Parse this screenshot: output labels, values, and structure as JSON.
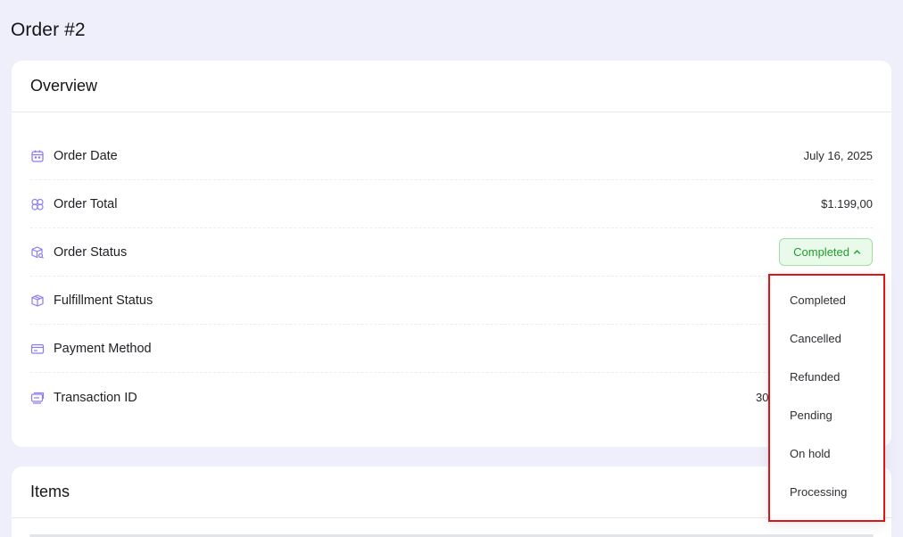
{
  "page": {
    "title": "Order #2"
  },
  "overview": {
    "heading": "Overview",
    "rows": [
      {
        "label": "Order Date",
        "value": "July 16, 2025",
        "icon": "calendar-icon"
      },
      {
        "label": "Order Total",
        "value": "$1.199,00",
        "icon": "coins-icon"
      },
      {
        "label": "Order Status",
        "value": "Completed",
        "icon": "package-search-icon"
      },
      {
        "label": "Fulfillment Status",
        "value": "",
        "icon": "box-icon"
      },
      {
        "label": "Payment Method",
        "value": "",
        "icon": "credit-card-icon"
      },
      {
        "label": "Transaction ID",
        "value": "30",
        "icon": "receipt-icon"
      }
    ]
  },
  "status_dropdown": {
    "options": [
      "Completed",
      "Cancelled",
      "Refunded",
      "Pending",
      "On hold",
      "Processing"
    ]
  },
  "items": {
    "heading": "Items"
  },
  "colors": {
    "background": "#efeffc",
    "icon_accent": "#8b7cf6",
    "status_green": "#1f9d2e",
    "status_bg": "#eafaea",
    "highlight_border": "#e01414"
  }
}
